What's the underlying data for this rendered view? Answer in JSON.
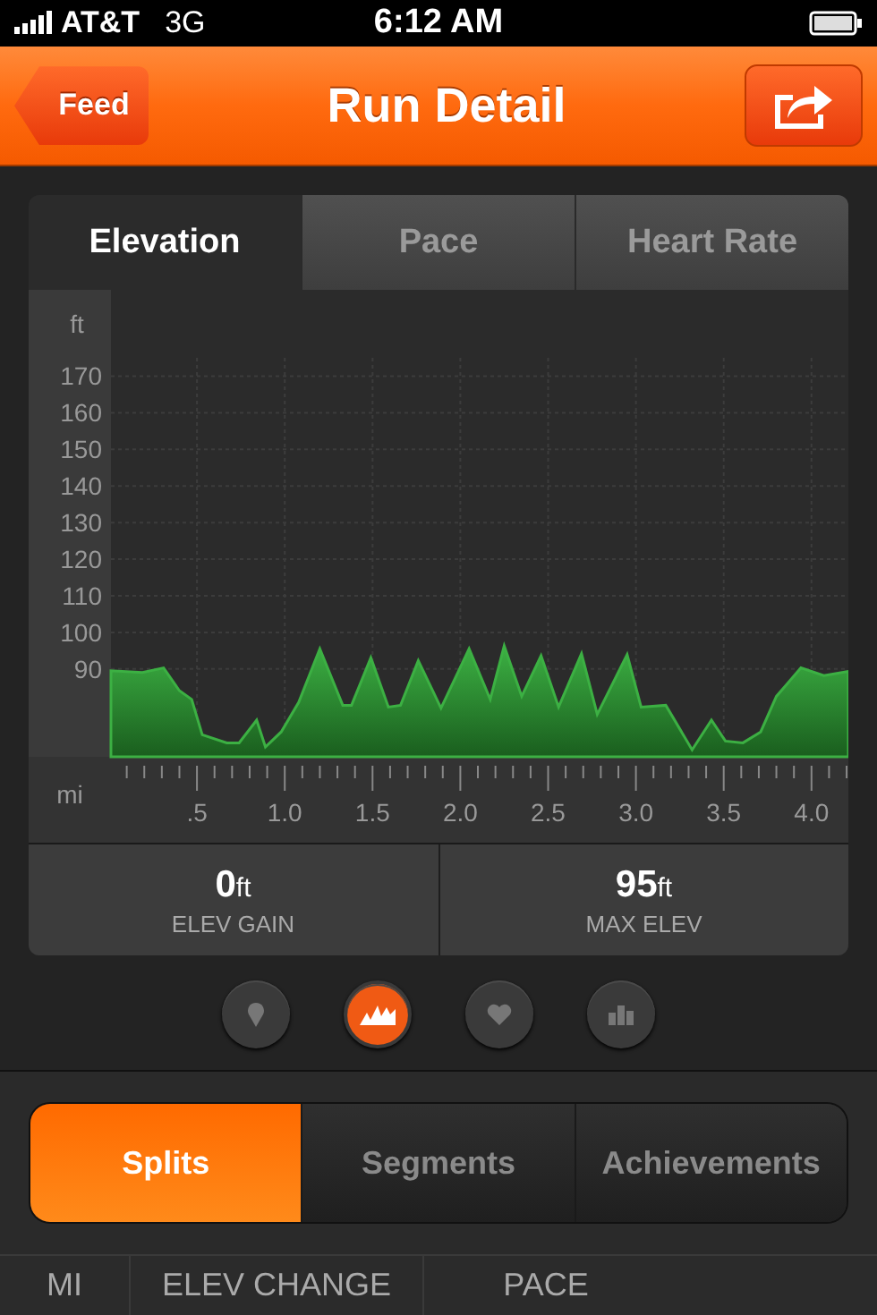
{
  "status_bar": {
    "carrier": "AT&T",
    "network": "3G",
    "time": "6:12 AM"
  },
  "nav_bar": {
    "back": "Feed",
    "title": "Run Detail"
  },
  "chart_tabs": [
    {
      "label": "Elevation",
      "selected": true
    },
    {
      "label": "Pace",
      "selected": false
    },
    {
      "label": "Heart Rate",
      "selected": false
    }
  ],
  "chart": {
    "chart_data": {
      "type": "area",
      "xlabel": "mi",
      "ylabel": "ft",
      "x": [
        0.01,
        0.19,
        0.31,
        0.4,
        0.47,
        0.53,
        0.67,
        0.74,
        0.84,
        0.89,
        0.98,
        1.08,
        1.2,
        1.33,
        1.38,
        1.49,
        1.59,
        1.66,
        1.76,
        1.89,
        2.05,
        2.17,
        2.25,
        2.35,
        2.46,
        2.56,
        2.69,
        2.78,
        2.95,
        3.03,
        3.17,
        3.32,
        3.43,
        3.51,
        3.61,
        3.71,
        3.8,
        3.94,
        4.07,
        4.21
      ],
      "series": [
        {
          "color": "#3cb043",
          "values": [
            89.5,
            89,
            90.3,
            84.1,
            81.7,
            72,
            69.8,
            69.8,
            76,
            68.7,
            72.8,
            80.9,
            95.5,
            80.1,
            80.1,
            93.1,
            79.6,
            80.1,
            92.3,
            79.3,
            95.5,
            81.7,
            96.3,
            82.5,
            93.6,
            79.6,
            94.2,
            77.6,
            93.9,
            79.6,
            80.1,
            67.9,
            76,
            70.3,
            69.8,
            72.8,
            82.5,
            90.3,
            88.2,
            89.3
          ]
        }
      ],
      "xlim": [
        0,
        4.21
      ],
      "ylim": [
        66,
        175
      ],
      "grid": true,
      "xticks": [
        {
          "value": 0.5,
          "label": ".5"
        },
        {
          "value": 1,
          "label": "1.0"
        },
        {
          "value": 1.5,
          "label": "1.5"
        },
        {
          "value": 2,
          "label": "2.0"
        },
        {
          "value": 2.5,
          "label": "2.5"
        },
        {
          "value": 3,
          "label": "3.0"
        },
        {
          "value": 3.5,
          "label": "3.5"
        },
        {
          "value": 4,
          "label": "4.0"
        }
      ],
      "yticks": [
        90,
        100,
        110,
        120,
        130,
        140,
        150,
        160,
        170
      ]
    }
  },
  "stats": [
    {
      "value": "0",
      "unit": "ft",
      "label": "ELEV GAIN"
    },
    {
      "value": "95",
      "unit": "ft",
      "label": "MAX ELEV"
    }
  ],
  "view_buttons": [
    {
      "kind": "map",
      "selected": false
    },
    {
      "kind": "elevation",
      "selected": true
    },
    {
      "kind": "heart",
      "selected": false
    },
    {
      "kind": "splits",
      "selected": false
    }
  ],
  "section_tabs": [
    {
      "label": "Splits",
      "selected": true
    },
    {
      "label": "Segments",
      "selected": false
    },
    {
      "label": "Achievements",
      "selected": false
    }
  ],
  "table": {
    "columns": [
      "MI",
      "ELEV CHANGE",
      "PACE"
    ]
  }
}
